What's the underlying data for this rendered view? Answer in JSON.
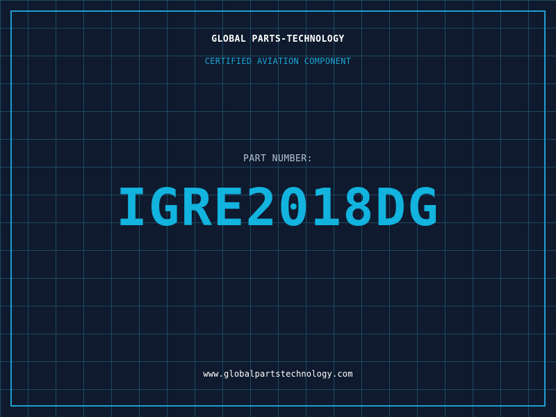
{
  "header": {
    "company": "GLOBAL PARTS-TECHNOLOGY",
    "subtitle": "CERTIFIED AVIATION COMPONENT"
  },
  "part": {
    "label": "PART NUMBER:",
    "number": "IGRE2018DG"
  },
  "footer": {
    "url": "www.globalpartstechnology.com"
  },
  "colors": {
    "background": "#0f1a2e",
    "grid": "#1c4a63",
    "frame": "#1e9fd0",
    "accent": "#12b3de",
    "subtitle": "#1aa6d6",
    "label": "#b8c4d4",
    "text": "#ffffff"
  }
}
